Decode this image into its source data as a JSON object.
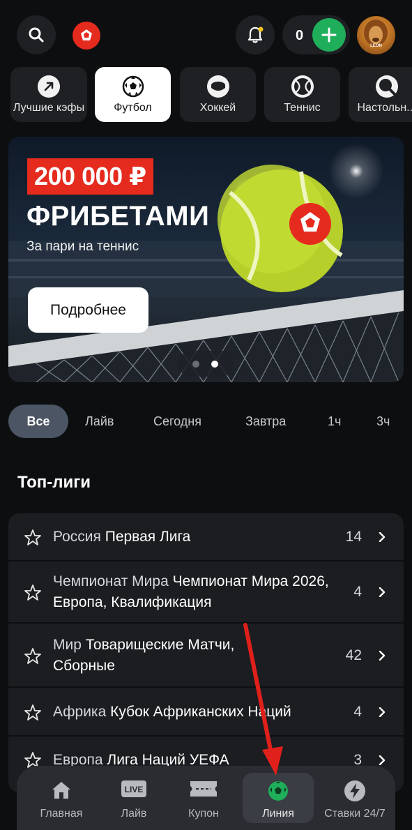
{
  "header": {
    "search_icon": "search-icon",
    "logo_icon": "brand-ball-logo",
    "notifications_icon": "bell-icon",
    "balance": "0",
    "deposit_icon": "plus-icon",
    "avatar_tag": "LEON"
  },
  "sports": [
    {
      "label": "Лучшие кэфы",
      "icon": "arrow-up-right-icon"
    },
    {
      "label": "Футбол",
      "icon": "soccer-ball-icon"
    },
    {
      "label": "Хоккей",
      "icon": "hockey-puck-icon"
    },
    {
      "label": "Теннис",
      "icon": "tennis-ball-icon"
    },
    {
      "label": "Настольн...",
      "icon": "table-tennis-icon"
    }
  ],
  "banner": {
    "price": "200 000 ₽",
    "title": "ФРИБЕТАМИ",
    "subtitle": "За пари на теннис",
    "button": "Подробнее",
    "active_slide": 2,
    "slides_total": 2
  },
  "filters": [
    "Все",
    "Лайв",
    "Сегодня",
    "Завтра",
    "1ч",
    "3ч"
  ],
  "section_title": "Топ-лиги",
  "leagues": [
    {
      "country": "Россия",
      "name": "Первая Лига",
      "count": "14"
    },
    {
      "country": "Чемпионат Мира",
      "name": "Чемпионат Мира 2026, Европа, Квалификация",
      "count": "4"
    },
    {
      "country": "Мир",
      "name": "Товарищеские Матчи, Сборные",
      "count": "42"
    },
    {
      "country": "Африка",
      "name": "Кубок Африканских Наций",
      "count": "4"
    },
    {
      "country": "Европа",
      "name": "Лига Наций УЕФА",
      "count": "3"
    }
  ],
  "bottom_nav": [
    {
      "label": "Главная",
      "icon": "home-icon"
    },
    {
      "label": "Лайв",
      "icon": "live-icon",
      "badge": "LIVE"
    },
    {
      "label": "Купон",
      "icon": "ticket-icon"
    },
    {
      "label": "Линия",
      "icon": "soccer-ball-icon"
    },
    {
      "label": "Ставки 24/7",
      "icon": "lightning-icon"
    }
  ],
  "colors": {
    "background": "#0d0e10",
    "card": "#1e2024",
    "accent_green": "#1fae5a",
    "brand_red": "#e52b1e",
    "annotation_arrow": "#e0201a"
  }
}
